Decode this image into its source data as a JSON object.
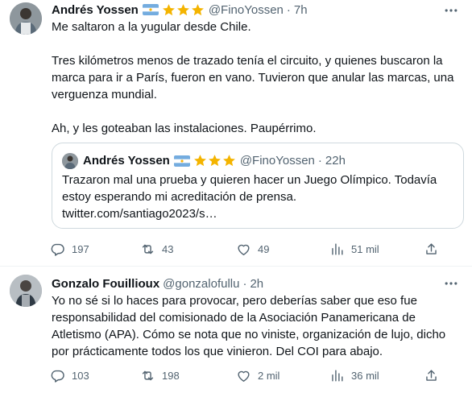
{
  "tweets": [
    {
      "author": "Andrés Yossen",
      "handle": "@FinoYossen",
      "separator": "·",
      "time": "7h",
      "text": [
        "Me saltaron a la yugular desde Chile.",
        "Tres kilómetros menos de trazado tenía el circuito, y quienes buscaron la marca para ir a París, fueron en vano. Tuvieron que anular las marcas, una verguenza mundial.",
        "Ah, y les goteaban las instalaciones. Paupérrimo."
      ],
      "quote": {
        "author": "Andrés Yossen",
        "handle": "@FinoYossen",
        "separator": "·",
        "time": "22h",
        "text": "Trazaron mal una prueba y quieren hacer un Juego Olímpico. Todavía estoy esperando mi acreditación de prensa.",
        "link": "twitter.com/santiago2023/s…"
      },
      "stats": {
        "replies": "197",
        "retweets": "43",
        "likes": "49",
        "views": "51 mil"
      }
    },
    {
      "author": "Gonzalo Fouillioux",
      "handle": "@gonzalofullu",
      "separator": "·",
      "time": "2h",
      "text": "Yo no sé si lo haces para provocar, pero deberías saber que eso fue responsabilidad del comisionado de la Asociación Panamericana de Atletismo (APA). Cómo se nota que no viniste, organización de lujo, dicho por prácticamente todos los que vinieron. Del COI para abajo.",
      "stats": {
        "replies": "103",
        "retweets": "198",
        "likes": "2 mil",
        "views": "36 mil"
      }
    }
  ],
  "icons": [
    "more-icon",
    "reply-icon",
    "retweet-icon",
    "like-icon",
    "views-icon",
    "share-icon",
    "argentina-flag-icon",
    "star-icon"
  ],
  "colors": {
    "text": "#0f1419",
    "secondary": "#536471",
    "border": "#cfd9de",
    "divider": "#eff3f4",
    "star": "#f4b400",
    "flag_blue": "#74acdf"
  }
}
